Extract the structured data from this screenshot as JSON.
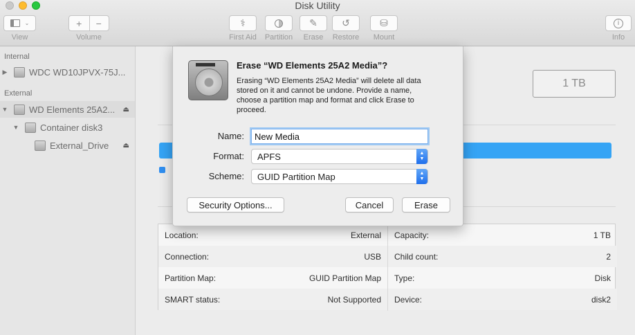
{
  "window": {
    "title": "Disk Utility"
  },
  "toolbar": {
    "view_label": "View",
    "volume_label": "Volume",
    "volume_add": "+",
    "volume_remove": "−",
    "first_aid_label": "First Aid",
    "partition_label": "Partition",
    "erase_label": "Erase",
    "restore_label": "Restore",
    "mount_label": "Mount",
    "info_label": "Info"
  },
  "sidebar": {
    "internal_header": "Internal",
    "external_header": "External",
    "items": [
      {
        "label": "WDC WD10JPVX-75J..."
      },
      {
        "label": "WD Elements 25A2..."
      },
      {
        "label": "Container disk3"
      },
      {
        "label": "External_Drive"
      }
    ]
  },
  "main": {
    "capacity_box": "1 TB",
    "info": {
      "left": [
        {
          "key": "Location:",
          "value": "External"
        },
        {
          "key": "Connection:",
          "value": "USB"
        },
        {
          "key": "Partition Map:",
          "value": "GUID Partition Map"
        },
        {
          "key": "SMART status:",
          "value": "Not Supported"
        }
      ],
      "right": [
        {
          "key": "Capacity:",
          "value": "1 TB"
        },
        {
          "key": "Child count:",
          "value": "2"
        },
        {
          "key": "Type:",
          "value": "Disk"
        },
        {
          "key": "Device:",
          "value": "disk2"
        }
      ]
    }
  },
  "dialog": {
    "title": "Erase “WD Elements 25A2 Media”?",
    "message": "Erasing “WD Elements 25A2 Media” will delete all data stored on it and cannot be undone. Provide a name, choose a partition map and format and click Erase to proceed.",
    "name_label": "Name:",
    "name_value": "New Media",
    "format_label": "Format:",
    "format_value": "APFS",
    "scheme_label": "Scheme:",
    "scheme_value": "GUID Partition Map",
    "security_button": "Security Options...",
    "cancel_button": "Cancel",
    "erase_button": "Erase"
  }
}
